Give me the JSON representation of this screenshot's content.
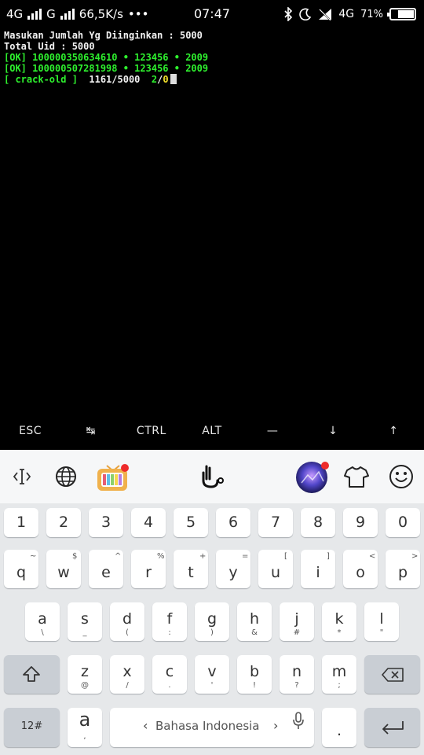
{
  "statusbar": {
    "net_left": "4G",
    "net_mid": "G",
    "speed": "66,5K/s",
    "dots": "•••",
    "time": "07:47",
    "net_right": "4G",
    "battery": "71%",
    "battery_level": 0.71
  },
  "terminal": {
    "lines": [
      {
        "text": "Masukan Jumlah Yg Diinginkan : 5000"
      },
      {
        "text": "Total Uid : 5000"
      },
      {
        "text": "[OK] 100000350634610 • 123456 • 2009"
      },
      {
        "text": "[OK] 100000507281998 • 123456 • 2009"
      }
    ],
    "progress": {
      "tag": "[ crack-old ]",
      "count": "1161/5000",
      "ok": "2",
      "sep": "/",
      "cp": "0"
    }
  },
  "extra_keys": [
    "ESC",
    "↹",
    "CTRL",
    "ALT",
    "—",
    "↓",
    "↑"
  ],
  "keyboard": {
    "numbers": [
      "1",
      "2",
      "3",
      "4",
      "5",
      "6",
      "7",
      "8",
      "9",
      "0"
    ],
    "row1": [
      {
        "m": "q",
        "s": "~"
      },
      {
        "m": "w",
        "s": "$"
      },
      {
        "m": "e",
        "s": "^"
      },
      {
        "m": "r",
        "s": "%"
      },
      {
        "m": "t",
        "s": "+"
      },
      {
        "m": "y",
        "s": "="
      },
      {
        "m": "u",
        "s": "["
      },
      {
        "m": "i",
        "s": "]"
      },
      {
        "m": "o",
        "s": "<"
      },
      {
        "m": "p",
        "s": ">"
      }
    ],
    "row2": [
      {
        "m": "a",
        "s": "\\"
      },
      {
        "m": "s",
        "s": "_"
      },
      {
        "m": "d",
        "s": "("
      },
      {
        "m": "f",
        "s": ":"
      },
      {
        "m": "g",
        "s": ")"
      },
      {
        "m": "h",
        "s": "&"
      },
      {
        "m": "j",
        "s": "#"
      },
      {
        "m": "k",
        "s": "*"
      },
      {
        "m": "l",
        "s": "\""
      }
    ],
    "row3": [
      {
        "m": "z",
        "s": "@"
      },
      {
        "m": "x",
        "s": "/"
      },
      {
        "m": "c",
        "s": "."
      },
      {
        "m": "v",
        "s": "'"
      },
      {
        "m": "b",
        "s": "!"
      },
      {
        "m": "n",
        "s": "?"
      },
      {
        "m": "m",
        "s": ";"
      }
    ],
    "symbols_label": "12#",
    "a_key": "a",
    "a_key_sub": ",",
    "space_label": "Bahasa Indonesia",
    "space_left": "‹",
    "space_right": "›",
    "period": "."
  }
}
